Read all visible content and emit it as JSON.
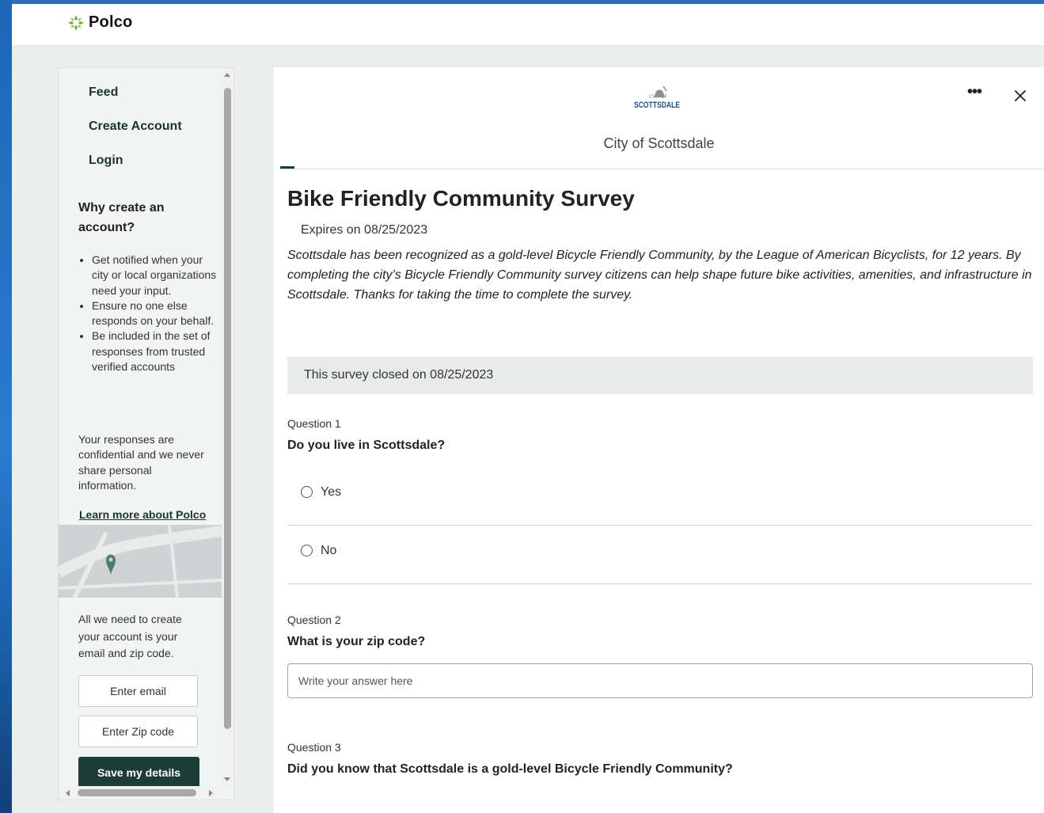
{
  "app": {
    "brand_name": "Polco",
    "brand_color": "#6fae3d"
  },
  "sidebar": {
    "nav": [
      {
        "label": "Feed"
      },
      {
        "label": "Create Account"
      },
      {
        "label": "Login"
      }
    ],
    "why_title": "Why create an account?",
    "benefits": [
      "Get notified when your city or local organizations need your input.",
      "Ensure no one else responds on your behalf.",
      "Be included in the set of responses from trusted verified accounts"
    ],
    "confidential_text": "Your responses are confidential and we never share personal information.",
    "learn_more_link": "Learn more about Polco",
    "need_text": "All we need to create your account is your email and zip code.",
    "email_placeholder": "Enter email",
    "zip_placeholder": "Enter Zip code",
    "save_button": "Save my details",
    "button_color": "#1c3d35"
  },
  "main": {
    "city_logo_text": "CITY OF SCOTTSDALE",
    "city_name": "City of Scottsdale",
    "more_icon": "more-horizontal-icon",
    "close_icon": "close-icon",
    "survey_title": "Bike Friendly Community Survey",
    "expires": "Expires on 08/25/2023",
    "description": "Scottsdale has been recognized as a gold-level Bicycle Friendly Community, by the League of American Bicyclists, for 12 years. By completing the city’s Bicycle Friendly Community survey citizens can help shape future bike activities, amenities, and infrastructure in Scottsdale. Thanks for taking the time to complete the survey.",
    "closed_banner": "This survey closed on 08/25/2023",
    "questions": [
      {
        "label": "Question 1",
        "text": "Do you live in Scottsdale?",
        "options": [
          "Yes",
          "No"
        ]
      },
      {
        "label": "Question 2",
        "text": "What is your zip code?",
        "placeholder": "Write your answer here"
      },
      {
        "label": "Question 3",
        "text": "Did you know that Scottsdale is a gold-level Bicycle Friendly Community?"
      }
    ]
  }
}
